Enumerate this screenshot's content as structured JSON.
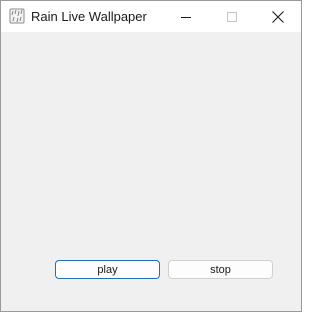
{
  "window": {
    "title": "Rain Live Wallpaper",
    "icon": "rain-app-icon",
    "controls": {
      "minimize_icon": "minimize-icon",
      "maximize_icon": "maximize-icon",
      "close_icon": "close-icon"
    }
  },
  "buttons": {
    "play_label": "play",
    "stop_label": "stop"
  },
  "colors": {
    "titlebar_bg": "#ffffff",
    "client_bg": "#f0f0f0",
    "focus_border": "#1f6fb4",
    "button_border": "#d0d0d0"
  }
}
